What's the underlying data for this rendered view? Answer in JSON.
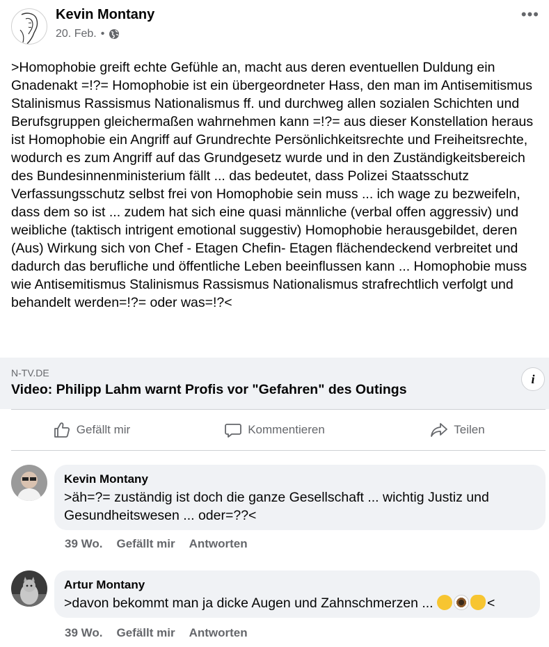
{
  "post": {
    "author": "Kevin Montany",
    "date": "20. Feb.",
    "dot": "•",
    "privacy_icon": "globe-icon",
    "more_icon": "•••",
    "text": ">Homophobie greift echte Gefühle an, macht aus deren eventuellen Duldung ein Gnadenakt =!?= Homophobie ist ein übergeordneter Hass, den man im Antisemitismus Stalinismus Rassismus Nationalismus ff. und durchweg allen sozialen Schichten und Berufsgruppen gleichermaßen wahrnehmen kann =!?= aus dieser Konstellation heraus ist Homophobie ein Angriff auf Grundrechte Persönlichkeitsrechte und Freiheitsrechte, wodurch es zum Angriff auf das Grundgesetz wurde und in den Zuständigkeitsbereich des Bundesinnenministerium fällt ... das bedeutet, dass Polizei Staatsschutz Verfassungsschutz selbst frei von Homophobie sein muss ... ich wage zu bezweifeln, dass dem so ist ... zudem hat sich eine quasi männliche (verbal offen aggressiv) und weibliche (taktisch intrigent emotional suggestiv) Homophobie herausgebildet, deren (Aus) Wirkung sich von Chef - Etagen Chefin- Etagen flächendeckend verbreitet und dadurch das berufliche und öffentliche Leben beeinflussen kann ... Homophobie muss wie Antisemitismus Stalinismus Rassismus Nationalismus strafrechtlich verfolgt und behandelt werden=!?= oder was=!?<"
  },
  "link": {
    "domain": "N-TV.DE",
    "title": "Video: Philipp Lahm warnt Profis vor \"Gefahren\" des Outings",
    "info_label": "i"
  },
  "actions": {
    "like": "Gefällt mir",
    "comment": "Kommentieren",
    "share": "Teilen"
  },
  "comments": [
    {
      "name": "Kevin Montany",
      "text_line1": ">äh=?= zuständig ist doch die ganze Gesellschaft ... wichtig Justiz und",
      "text_line2": "Gesundheitswesen ... oder=??<",
      "time": "39 Wo.",
      "like": "Gefällt mir",
      "reply": "Antworten"
    },
    {
      "name": "Artur Montany",
      "text": ">davon bekommt man ja dicke Augen und Zahnschmerzen ...",
      "text_end": "<",
      "emojis": [
        "yawning-face-emoji",
        "eye-emoji",
        "grinning-cat-emoji"
      ],
      "time": "39 Wo.",
      "like": "Gefällt mir",
      "reply": "Antworten"
    }
  ]
}
